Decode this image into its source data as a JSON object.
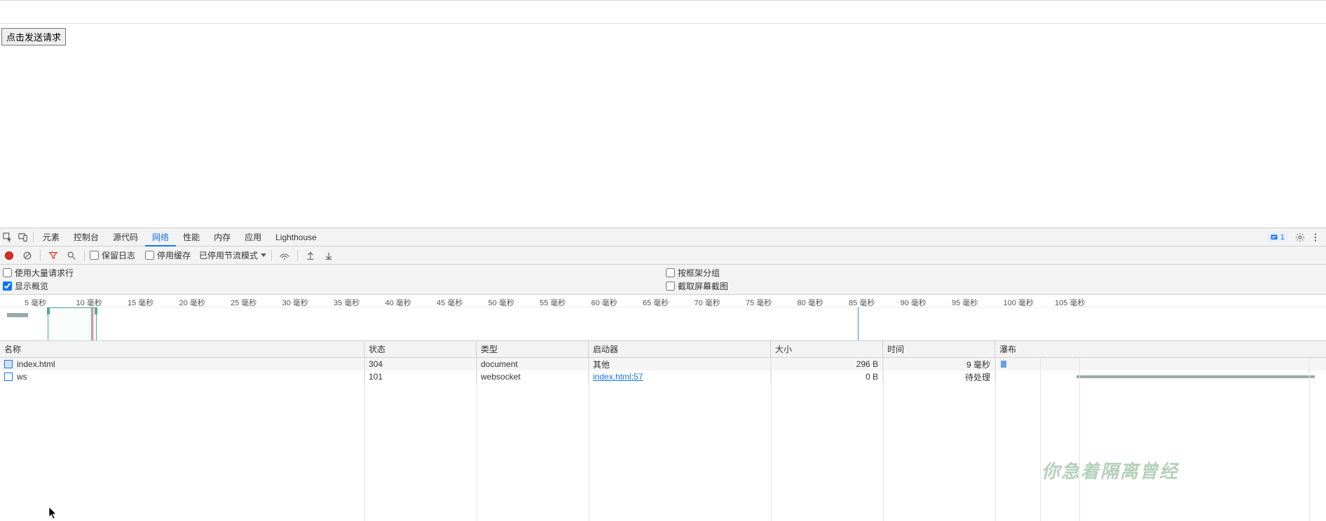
{
  "page": {
    "send_button": "点击发送请求"
  },
  "devtools": {
    "tabs": [
      "元素",
      "控制台",
      "源代码",
      "网络",
      "性能",
      "内存",
      "应用",
      "Lighthouse"
    ],
    "active_tab_index": 3,
    "issues_count": "1"
  },
  "network": {
    "toolbar": {
      "preserve_log": "保留日志",
      "disable_cache": "停用缓存",
      "throttling": "已停用节流模式"
    },
    "options": {
      "large_rows": "使用大量请求行",
      "group_by_frame": "按框架分组",
      "show_overview": "显示概览",
      "screenshots": "截取屏幕截图"
    },
    "options_checked": {
      "large_rows": false,
      "group_by_frame": false,
      "show_overview": true,
      "screenshots": false
    }
  },
  "timeline": {
    "ticks": [
      "5 毫秒",
      "10 毫秒",
      "15 毫秒",
      "20 毫秒",
      "25 毫秒",
      "30 毫秒",
      "35 毫秒",
      "40 毫秒",
      "45 毫秒",
      "50 毫秒",
      "55 毫秒",
      "60 毫秒",
      "65 毫秒",
      "70 毫秒",
      "75 毫秒",
      "80 毫秒",
      "85 毫秒",
      "90 毫秒",
      "95 毫秒",
      "100 毫秒",
      "105 毫秒"
    ]
  },
  "grid": {
    "headers": {
      "name": "名称",
      "status": "状态",
      "type": "类型",
      "initiator": "启动器",
      "size": "大小",
      "time": "时间",
      "waterfall": "瀑布"
    },
    "rows": [
      {
        "name": "index.html",
        "status": "304",
        "type": "document",
        "initiator": "其他",
        "initiator_link": false,
        "size": "296 B",
        "time": "9 毫秒",
        "icon": "doc"
      },
      {
        "name": "ws",
        "status": "101",
        "type": "websocket",
        "initiator": "index.html:57",
        "initiator_link": true,
        "size": "0 B",
        "time": "待处理",
        "icon": "ws"
      }
    ]
  },
  "watermark": "你急着隔离曾经"
}
